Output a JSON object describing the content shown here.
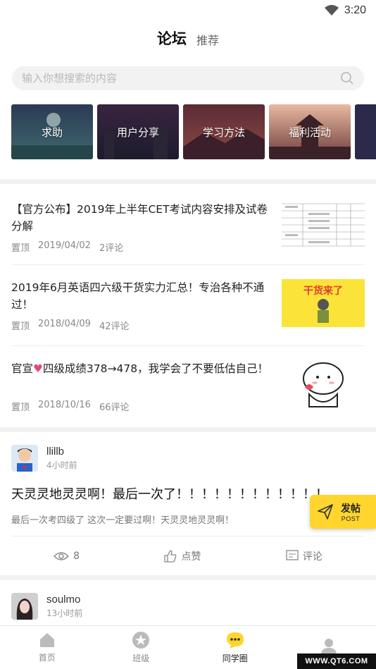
{
  "status_bar": {
    "time": "3:20"
  },
  "header": {
    "active_tab": "论坛",
    "tab_recommend": "推荐"
  },
  "search": {
    "placeholder": "输入你想搜索的内容"
  },
  "categories": [
    {
      "label": "求助"
    },
    {
      "label": "用户分享"
    },
    {
      "label": "学习方法"
    },
    {
      "label": "福利活动"
    }
  ],
  "articles": [
    {
      "title": "【官方公布】2019年上半年CET考试内容安排及试卷分解",
      "tag": "置顶",
      "date": "2019/04/02",
      "comments": "2评论"
    },
    {
      "title": "2019年6月英语四六级干货实力汇总！专治各种不通过！",
      "tag": "置顶",
      "date": "2018/04/09",
      "comments": "42评论",
      "thumb_text": "干货来了"
    },
    {
      "title_prefix": "官宣",
      "title_rest": "四级成绩378→478，我学会了不要低估自己！",
      "tag": "置顶",
      "date": "2018/10/16",
      "comments": "66评论"
    }
  ],
  "post": {
    "user": "llillb",
    "time": "4小时前",
    "title": "天灵灵地灵灵啊！最后一次了！！！！！！！！！！！！",
    "body": "最后一次考四级了 这次一定要过啊！天灵灵地灵灵啊！",
    "views": "8",
    "like_label": "点赞",
    "comment_label": "评论"
  },
  "post2": {
    "user": "soulmo",
    "time": "13小时前"
  },
  "fab": {
    "label": "发帖",
    "sub": "POST"
  },
  "nav": [
    {
      "label": "首页"
    },
    {
      "label": "班级"
    },
    {
      "label": "同学圈"
    },
    {
      "label": ""
    }
  ],
  "watermark": "WWW.QT6.COM",
  "colors": {
    "accent": "#ffd52e"
  }
}
